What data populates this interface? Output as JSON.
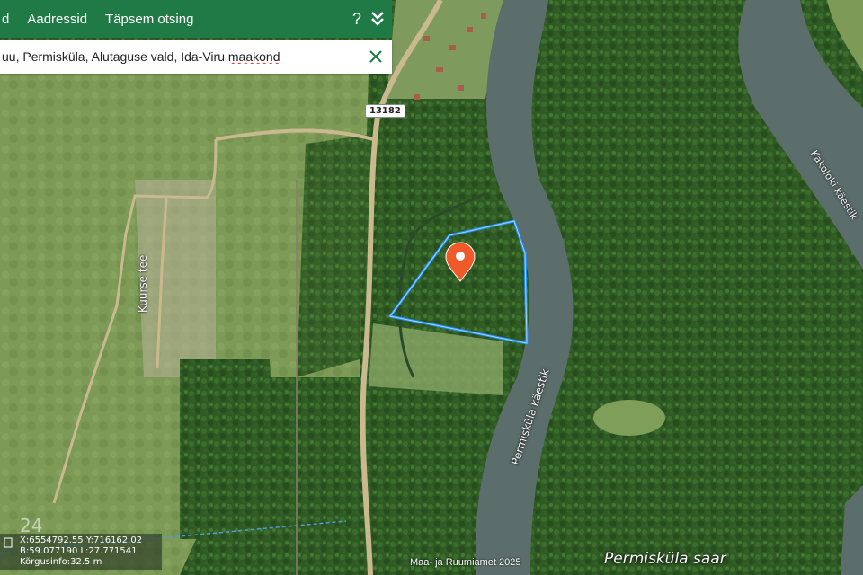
{
  "toolbar": {
    "tab_partial": "d",
    "tab_addresses": "Aadressid",
    "tab_advanced": "Täpsem otsing",
    "help_label": "?"
  },
  "search": {
    "value_prefix": "uu, Permisküla, Alutaguse vald, Ida-Viru ",
    "value_underlined": "maakond"
  },
  "map": {
    "road_number": "13182",
    "street_label": "Kuurse tee",
    "river_label": "Permisküla käestik",
    "river_label_2": "Kakoloki käestik",
    "island_label": "Permisküla saar",
    "zoom_level": "24",
    "coord_line1": "X:6554792.55 Y:716162.02",
    "coord_line2": "B:59.077190 L:27.771541",
    "coord_line3": "Kõrgusinfo:32.5 m",
    "copyright": "Maa- ja Ruumiamet 2025"
  },
  "colors": {
    "header_green": "#1f7a45",
    "parcel_outline": "#1e90ff",
    "marker": "#f05a28",
    "river": "#5b6e6b"
  },
  "icons": [
    "help-icon",
    "chevron-double-down-icon",
    "close-icon",
    "map-marker-icon",
    "coordinates-icon"
  ]
}
